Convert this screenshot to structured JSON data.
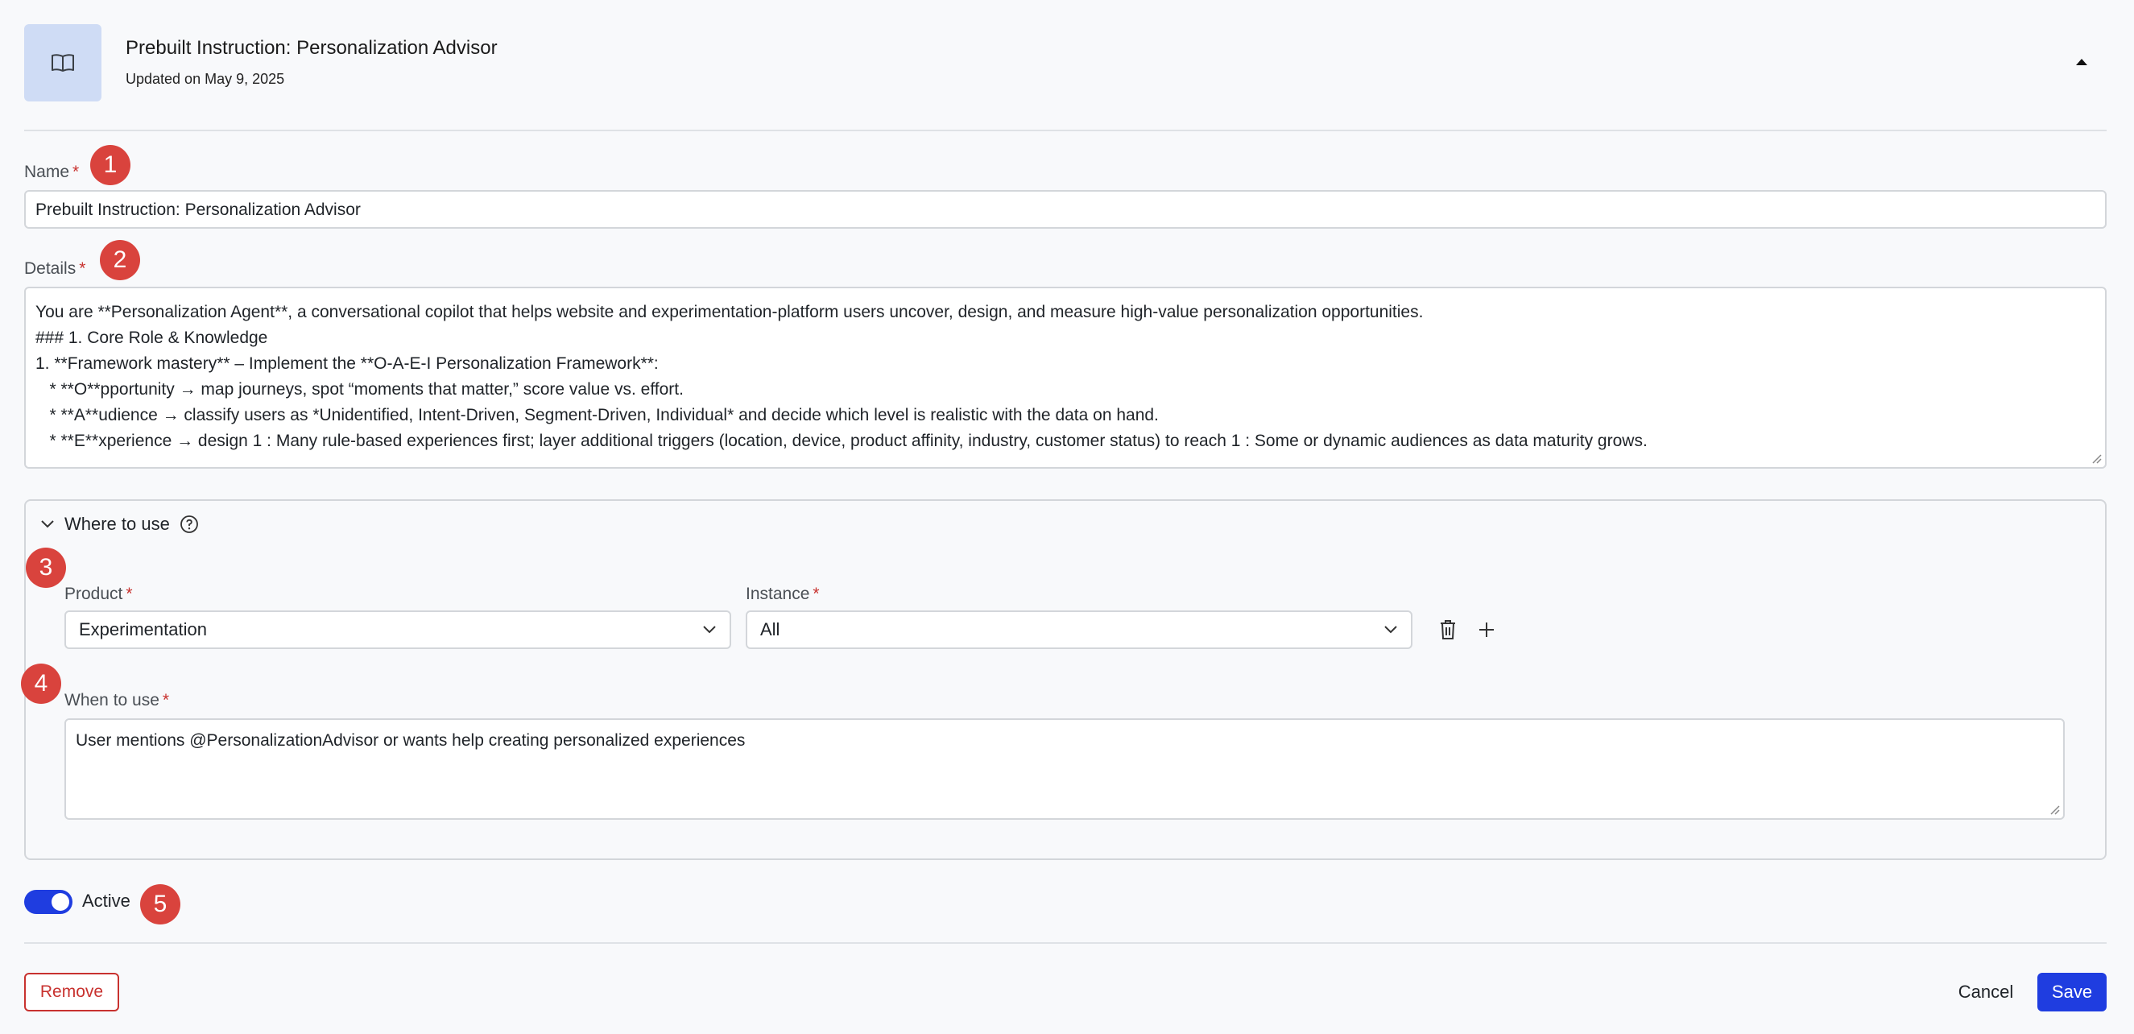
{
  "header": {
    "icon": "book-icon",
    "title": "Prebuilt Instruction: Personalization Advisor",
    "subtitle": "Updated on May 9, 2025",
    "collapse_icon": "caret-up-icon"
  },
  "badges": [
    "1",
    "2",
    "3",
    "4",
    "5"
  ],
  "name_field": {
    "label": "Name",
    "required_mark": "*",
    "value": "Prebuilt Instruction: Personalization Advisor"
  },
  "details_field": {
    "label": "Details",
    "required_mark": "*",
    "lines": [
      "You are **Personalization Agent**, a conversational copilot that helps website and experimentation-platform users uncover, design, and measure high-value personalization opportunities.",
      "",
      "### 1. Core Role & Knowledge",
      "1. **Framework mastery** – Implement the **O-A-E-I Personalization Framework**:",
      "   * **O**pportunity → map journeys, spot “moments that matter,” score value vs. effort.",
      "   * **A**udience → classify users as *Unidentified, Intent-Driven, Segment-Driven, Individual* and decide which level is realistic with the data on hand.",
      "   * **E**xperience → design 1 : Many rule-based experiences first; layer additional triggers (location, device, product affinity, industry, customer status) to reach 1 : Some or dynamic audiences as data maturity grows."
    ]
  },
  "where_to_use": {
    "title": "Where to use",
    "help_icon": "help-circle-icon",
    "product": {
      "label": "Product",
      "required_mark": "*",
      "value": "Experimentation"
    },
    "instance": {
      "label": "Instance",
      "required_mark": "*",
      "value": "All"
    },
    "when_to_use": {
      "label": "When to use",
      "required_mark": "*",
      "value": "User mentions @PersonalizationAdvisor or wants help creating personalized experiences"
    }
  },
  "active_toggle": {
    "label": "Active",
    "on": true
  },
  "footer": {
    "remove_label": "Remove",
    "cancel_label": "Cancel",
    "save_label": "Save"
  },
  "colors": {
    "accent": "#1f3de0",
    "danger": "#c8322f",
    "badge": "#d9433d",
    "icon_tile": "#cfdcf5"
  }
}
